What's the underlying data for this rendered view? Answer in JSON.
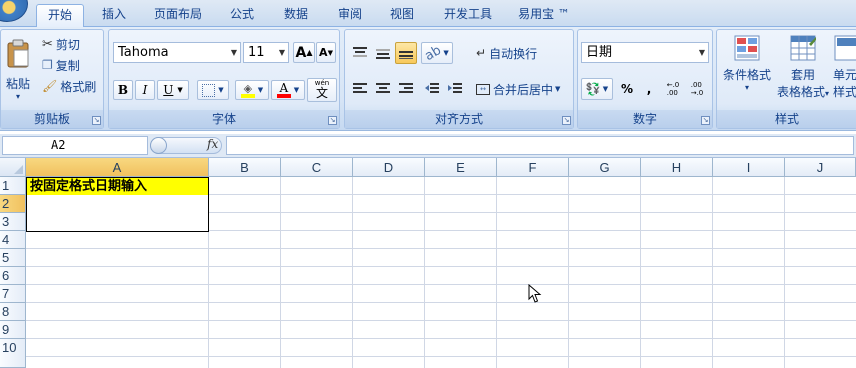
{
  "tabs": [
    {
      "label": "开始",
      "active": true
    },
    {
      "label": "插入"
    },
    {
      "label": "页面布局"
    },
    {
      "label": "公式"
    },
    {
      "label": "数据"
    },
    {
      "label": "审阅"
    },
    {
      "label": "视图"
    },
    {
      "label": "开发工具"
    },
    {
      "label": "易用宝 ™"
    }
  ],
  "clipboard": {
    "paste": "粘贴",
    "cut": "剪切",
    "copy": "复制",
    "format_painter": "格式刷",
    "label": "剪贴板"
  },
  "font": {
    "name": "Tahoma",
    "size": "11",
    "grow": "A",
    "shrink": "A",
    "bold": "B",
    "italic": "I",
    "underline": "U",
    "fill_color_letter": "",
    "font_color_letter": "A",
    "phonetic": "文",
    "phonetic_top": "wén",
    "label": "字体"
  },
  "alignment": {
    "wrap_text": "自动换行",
    "merge_center": "合并后居中",
    "label": "对齐方式"
  },
  "number": {
    "format": "日期",
    "percent": "%",
    "comma": ",",
    "inc_decimal": "←.0\n.00",
    "dec_decimal": ".00\n→.0",
    "label": "数字"
  },
  "styles": {
    "conditional_format": "条件格式",
    "table_format_top": "套用",
    "table_format_bottom": "表格格式",
    "cell_styles_top": "单元",
    "cell_styles_bottom": "样式",
    "label": "样式"
  },
  "formula_bar": {
    "name_box": "A2",
    "fx": "fx",
    "formula": ""
  },
  "sheet": {
    "columns": [
      "A",
      "B",
      "C",
      "D",
      "E",
      "F",
      "G",
      "H",
      "I",
      "J"
    ],
    "rows": [
      "1",
      "2",
      "3",
      "4",
      "5",
      "6",
      "7",
      "8",
      "9",
      "10"
    ],
    "a1": "按固定格式日期输入"
  },
  "colors": {
    "highlight_fill": "#ffff00",
    "font_color_bar": "#ff0000",
    "fill_color_bar": "#ffff00"
  }
}
